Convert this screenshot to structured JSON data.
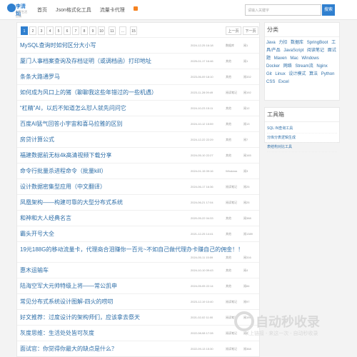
{
  "header": {
    "logo_title": "李清灿",
    "logo_sub": "分享生活点滴",
    "nav": [
      "首页",
      "Json格式化工具",
      "流量卡代理"
    ],
    "search_placeholder": "请输入关键字",
    "search_button": "搜索"
  },
  "pager": {
    "pages": [
      "1",
      "2",
      "3",
      "4",
      "5",
      "6",
      "7",
      "8",
      "9",
      "10",
      "11",
      "...",
      "15"
    ],
    "active": "1",
    "prev": "上一页",
    "next": "下一页"
  },
  "posts": [
    {
      "title": "MySQL查询时如何区分大小写",
      "date": "2024-12-25 16:18",
      "category": "数据库",
      "views": "阅1"
    },
    {
      "title": "厦门人事档案查询及存档证明（或调档函）打印地址",
      "date": "2025-01-17 16:46",
      "category": "其他",
      "views": "阅1"
    },
    {
      "title": "条条大路通罗马",
      "date": "2023-06-09 18:10",
      "category": "其他",
      "views": "阅332"
    },
    {
      "title": "如何成为风口上的猪（聊聊我这些年错过的一些机遇）",
      "date": "2023-11-28 09:49",
      "category": "阅读笔记",
      "views": "阅192"
    },
    {
      "title": "“杠精”AI，以后不知道怎么怼人就先问问它",
      "date": "2024-10-23 15:11",
      "category": "其他",
      "views": "阅12"
    },
    {
      "title": "百度AI猛气回答小宇宙和喜马拉雅的区别",
      "date": "2024-10-12 15:59",
      "category": "其他",
      "views": "阅13"
    },
    {
      "title": "房贷计算公式",
      "date": "2024-12-22 22:29",
      "category": "其他",
      "views": "阅7"
    },
    {
      "title": "福建数据前无标4k高清视频下载分享",
      "date": "2024-05-10 22:27",
      "category": "其他",
      "views": "阅165"
    },
    {
      "title": "命令行批量杀进程命令（批量kill）",
      "date": "2024-01-15 09:16",
      "category": "Windows",
      "views": "阅3"
    },
    {
      "title": "设计数据密集型应用（中文翻译）",
      "date": "2024-06-17 16:36",
      "category": "阅读笔记",
      "views": "阅25"
    },
    {
      "title": "凤凰架构——构建可靠的大型分布式系统",
      "date": "2024-06-21 17:04",
      "category": "阅读笔记",
      "views": "阅25"
    },
    {
      "title": "和神和大人经典名言",
      "date": "2020-05-22 04:33",
      "category": "其他",
      "views": "阅388"
    },
    {
      "title": "霸头开号大全",
      "date": "2021-12-25 14:41",
      "category": "其他",
      "views": "阅1389"
    },
    {
      "title": "19元188G的移动流量卡，代理商合泪赚你一百元~不如自己做代理办卡赚自己的佣金！！",
      "date": "2024-05-11 15:59",
      "category": "其他",
      "views": "阅316"
    },
    {
      "title": "惠木运输车",
      "date": "2024-10-10 09:43",
      "category": "其他",
      "views": "阅4"
    },
    {
      "title": "陆海空军大元帅特级上将——常公凯申",
      "date": "2024-05-05 22:14",
      "category": "其他",
      "views": "阅84"
    },
    {
      "title": "常见分布式系统设计图解-四火的唠叨",
      "date": "2023-12-19 10:40",
      "category": "阅读笔记",
      "views": "阅97"
    },
    {
      "title": "好文推荐：过度设计的架构师们，应该拿去祭天",
      "date": "2021-02-02 11:00",
      "category": "阅读笔记",
      "views": "阅194"
    },
    {
      "title": "灰度思维：生活处处皆可灰度",
      "date": "2022-08-08 17:28",
      "category": "阅读笔记",
      "views": "阅8"
    },
    {
      "title": "面试官：你觉得你最大的缺点是什么？",
      "date": "2022-09-13 15:30",
      "category": "阅读笔记",
      "views": "阅368"
    }
  ],
  "sidebar": {
    "category_title": "分类",
    "categories": [
      "Java",
      "力扣",
      "数据库",
      "SpringBoot",
      "工具/产品",
      "JavaScript",
      "阅读笔记",
      "面试题",
      "Maven",
      "Mac",
      "Windows",
      "Docker",
      "网络",
      "Stream流",
      "Nginx",
      "Git",
      "Linux",
      "设计模式",
      "算法",
      "Python",
      "CSS",
      "Excel"
    ],
    "tools_title": "工具箱",
    "tools": [
      "SQL IN查询工具",
      "分库分表逻辑生成",
      "表结构对比工具"
    ]
  },
  "watermark": {
    "text": "自动秒收录",
    "sub": "以上链接 - 来这一次 - 自动秒收录"
  }
}
